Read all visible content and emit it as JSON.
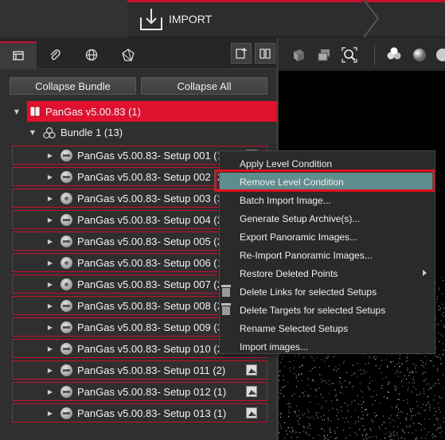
{
  "topbar": {
    "import_label": "IMPORT"
  },
  "panel": {
    "collapse_bundle_label": "Collapse Bundle",
    "collapse_all_label": "Collapse All"
  },
  "tree": {
    "root_label": "PanGas v5.00.83 (1)",
    "bundle_label": "Bundle 1 (13)",
    "setups": [
      {
        "label": "PanGas v5.00.83- Setup 001 (1)",
        "icon": "setup-minus-icon"
      },
      {
        "label": "PanGas v5.00.83- Setup 002 (2)",
        "icon": "setup-minus-icon"
      },
      {
        "label": "PanGas v5.00.83- Setup 003 (3)",
        "icon": "setup-dot-icon"
      },
      {
        "label": "PanGas v5.00.83- Setup 004 (2)",
        "icon": "setup-minus-icon"
      },
      {
        "label": "PanGas v5.00.83- Setup 005 (2)",
        "icon": "setup-minus-icon"
      },
      {
        "label": "PanGas v5.00.83- Setup 006 (1)",
        "icon": "setup-dot-icon"
      },
      {
        "label": "PanGas v5.00.83- Setup 007 (2)",
        "icon": "setup-dot-icon"
      },
      {
        "label": "PanGas v5.00.83- Setup 008 (2)",
        "icon": "setup-minus-icon"
      },
      {
        "label": "PanGas v5.00.83- Setup 009 (3)",
        "icon": "setup-minus-icon"
      },
      {
        "label": "PanGas v5.00.83- Setup 010 (2)",
        "icon": "setup-minus-icon"
      },
      {
        "label": "PanGas v5.00.83- Setup 011 (2)",
        "icon": "setup-minus-icon"
      },
      {
        "label": "PanGas v5.00.83- Setup 012 (1)",
        "icon": "setup-minus-icon"
      },
      {
        "label": "PanGas v5.00.83- Setup 013 (1)",
        "icon": "setup-minus-icon"
      }
    ]
  },
  "context_menu": {
    "items": [
      "Apply Level Condition",
      "Remove Level Condition",
      "Batch Import Image...",
      "Generate Setup Archive(s)...",
      "Export Panoramic Images...",
      "Re-Import Panoramic Images...",
      "Restore Deleted Points",
      "Delete Links for selected Setups",
      "Delete Targets for selected Setups",
      "Rename Selected Setups",
      "Import images..."
    ],
    "highlighted": "Remove Level Condition"
  },
  "colors": {
    "accent_red": "#e0102f",
    "highlight_teal": "#5f8c8c"
  }
}
